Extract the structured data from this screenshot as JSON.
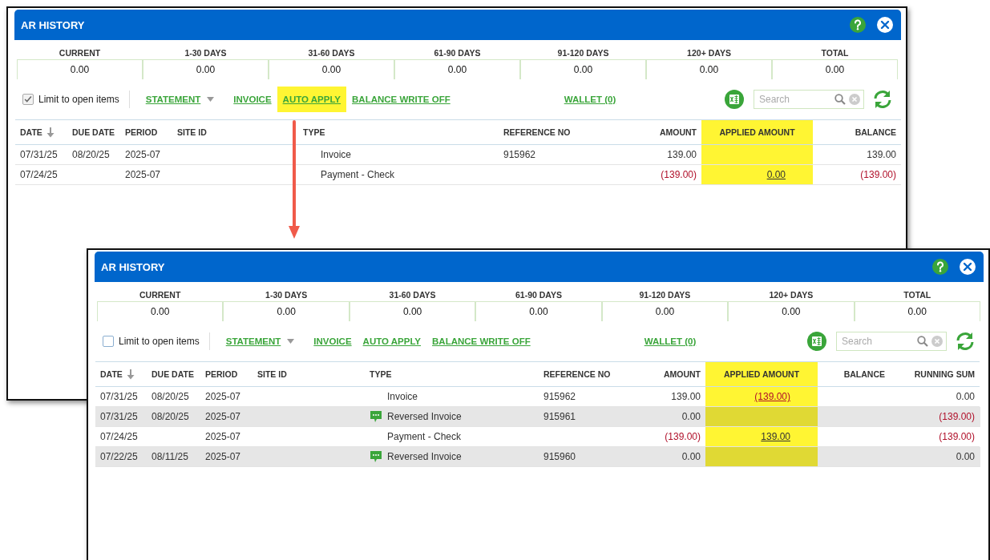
{
  "windows": [
    {
      "title": "AR HISTORY",
      "aging": [
        {
          "label": "CURRENT",
          "value": "0.00"
        },
        {
          "label": "1-30 DAYS",
          "value": "0.00"
        },
        {
          "label": "31-60 DAYS",
          "value": "0.00"
        },
        {
          "label": "61-90 DAYS",
          "value": "0.00"
        },
        {
          "label": "91-120 DAYS",
          "value": "0.00"
        },
        {
          "label": "120+ DAYS",
          "value": "0.00"
        },
        {
          "label": "TOTAL",
          "value": "0.00"
        }
      ],
      "limit": {
        "label": "Limit to open items",
        "checked": true
      },
      "actions": [
        {
          "label": "STATEMENT",
          "kind": "dropdown",
          "highlighted": false
        },
        {
          "label": "INVOICE",
          "kind": "link",
          "highlighted": false
        },
        {
          "label": "AUTO APPLY",
          "kind": "link",
          "highlighted": true
        },
        {
          "label": "BALANCE WRITE OFF",
          "kind": "link",
          "highlighted": false
        }
      ],
      "wallet": "WALLET (0)",
      "search": {
        "placeholder": "Search"
      },
      "columns": [
        {
          "label": "DATE",
          "sorted": true,
          "highlighted": false
        },
        {
          "label": "DUE DATE",
          "sorted": false,
          "highlighted": false
        },
        {
          "label": "PERIOD",
          "sorted": false,
          "highlighted": false
        },
        {
          "label": "SITE ID",
          "sorted": false,
          "highlighted": false
        },
        {
          "label": "TYPE",
          "sorted": false,
          "highlighted": false
        },
        {
          "label": "REFERENCE NO",
          "sorted": false,
          "highlighted": false
        },
        {
          "label": "AMOUNT",
          "sorted": false,
          "highlighted": false
        },
        {
          "label": "APPLIED AMOUNT",
          "sorted": false,
          "highlighted": true
        },
        {
          "label": "BALANCE",
          "sorted": false,
          "highlighted": false
        }
      ],
      "rows": [
        {
          "shaded": false,
          "note": false,
          "cells": [
            {
              "text": "07/31/25"
            },
            {
              "text": "08/20/25"
            },
            {
              "text": "2025-07"
            },
            null,
            {
              "text": "Invoice"
            },
            {
              "text": "915962"
            },
            {
              "text": "139.00",
              "negative": false
            },
            null,
            {
              "text": "139.00",
              "negative": false
            }
          ]
        },
        {
          "shaded": false,
          "note": false,
          "cells": [
            {
              "text": "07/24/25"
            },
            null,
            {
              "text": "2025-07"
            },
            null,
            {
              "text": "Payment - Check"
            },
            null,
            {
              "text": "(139.00)",
              "negative": true
            },
            {
              "text": "0.00",
              "negative": false,
              "link": true
            },
            {
              "text": "(139.00)",
              "negative": true
            }
          ]
        }
      ]
    },
    {
      "title": "AR HISTORY",
      "aging": [
        {
          "label": "CURRENT",
          "value": "0.00"
        },
        {
          "label": "1-30 DAYS",
          "value": "0.00"
        },
        {
          "label": "31-60 DAYS",
          "value": "0.00"
        },
        {
          "label": "61-90 DAYS",
          "value": "0.00"
        },
        {
          "label": "91-120 DAYS",
          "value": "0.00"
        },
        {
          "label": "120+ DAYS",
          "value": "0.00"
        },
        {
          "label": "TOTAL",
          "value": "0.00"
        }
      ],
      "limit": {
        "label": "Limit to open items",
        "checked": false
      },
      "actions": [
        {
          "label": "STATEMENT",
          "kind": "dropdown",
          "highlighted": false
        },
        {
          "label": "INVOICE",
          "kind": "link",
          "highlighted": false
        },
        {
          "label": "AUTO APPLY",
          "kind": "link",
          "highlighted": false
        },
        {
          "label": "BALANCE WRITE OFF",
          "kind": "link",
          "highlighted": false
        }
      ],
      "wallet": "WALLET (0)",
      "search": {
        "placeholder": "Search"
      },
      "columns": [
        {
          "label": "DATE",
          "sorted": true,
          "highlighted": false
        },
        {
          "label": "DUE DATE",
          "sorted": false,
          "highlighted": false
        },
        {
          "label": "PERIOD",
          "sorted": false,
          "highlighted": false
        },
        {
          "label": "SITE ID",
          "sorted": false,
          "highlighted": false
        },
        {
          "label": "TYPE",
          "sorted": false,
          "highlighted": false
        },
        {
          "label": "REFERENCE NO",
          "sorted": false,
          "highlighted": false
        },
        {
          "label": "AMOUNT",
          "sorted": false,
          "highlighted": false
        },
        {
          "label": "APPLIED AMOUNT",
          "sorted": false,
          "highlighted": true
        },
        {
          "label": "BALANCE",
          "sorted": false,
          "highlighted": false
        },
        {
          "label": "RUNNING SUM",
          "sorted": false,
          "highlighted": false
        }
      ],
      "rows": [
        {
          "shaded": false,
          "note": false,
          "cells": [
            {
              "text": "07/31/25"
            },
            {
              "text": "08/20/25"
            },
            {
              "text": "2025-07"
            },
            null,
            {
              "text": "Invoice"
            },
            {
              "text": "915962"
            },
            {
              "text": "139.00",
              "negative": false
            },
            {
              "text": "(139.00)",
              "negative": true,
              "link": true
            },
            null,
            {
              "text": "0.00",
              "negative": false
            }
          ]
        },
        {
          "shaded": true,
          "note": true,
          "cells": [
            {
              "text": "07/31/25"
            },
            {
              "text": "08/20/25"
            },
            {
              "text": "2025-07"
            },
            null,
            {
              "text": "Reversed Invoice"
            },
            {
              "text": "915961"
            },
            {
              "text": "0.00",
              "negative": false
            },
            null,
            null,
            {
              "text": "(139.00)",
              "negative": true
            }
          ]
        },
        {
          "shaded": false,
          "note": false,
          "cells": [
            {
              "text": "07/24/25"
            },
            null,
            {
              "text": "2025-07"
            },
            null,
            {
              "text": "Payment - Check"
            },
            null,
            {
              "text": "(139.00)",
              "negative": true
            },
            {
              "text": "139.00",
              "negative": false,
              "link": true
            },
            null,
            {
              "text": "(139.00)",
              "negative": true
            }
          ]
        },
        {
          "shaded": true,
          "note": true,
          "cells": [
            {
              "text": "07/22/25"
            },
            {
              "text": "08/11/25"
            },
            {
              "text": "2025-07"
            },
            null,
            {
              "text": "Reversed Invoice"
            },
            {
              "text": "915960"
            },
            {
              "text": "0.00",
              "negative": false
            },
            null,
            null,
            {
              "text": "0.00",
              "negative": false
            }
          ]
        }
      ]
    }
  ]
}
